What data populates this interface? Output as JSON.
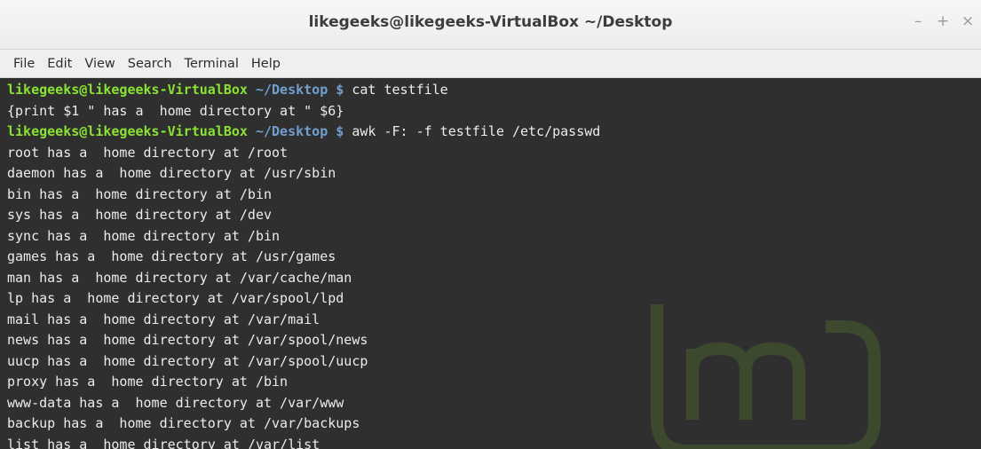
{
  "window": {
    "title": "likegeeks@likegeeks-VirtualBox ~/Desktop",
    "controls": {
      "minimize": "–",
      "maximize": "+",
      "close": "×"
    }
  },
  "menubar": {
    "items": [
      "File",
      "Edit",
      "View",
      "Search",
      "Terminal",
      "Help"
    ]
  },
  "terminal": {
    "lines": [
      {
        "type": "prompt",
        "user": "likegeeks@likegeeks-VirtualBox",
        "path": " ~/Desktop $ ",
        "cmd": "cat testfile"
      },
      {
        "type": "output",
        "text": "{print $1 \" has a  home directory at \" $6}"
      },
      {
        "type": "prompt",
        "user": "likegeeks@likegeeks-VirtualBox",
        "path": " ~/Desktop $ ",
        "cmd": "awk -F: -f testfile /etc/passwd"
      },
      {
        "type": "output",
        "text": "root has a  home directory at /root"
      },
      {
        "type": "output",
        "text": "daemon has a  home directory at /usr/sbin"
      },
      {
        "type": "output",
        "text": "bin has a  home directory at /bin"
      },
      {
        "type": "output",
        "text": "sys has a  home directory at /dev"
      },
      {
        "type": "output",
        "text": "sync has a  home directory at /bin"
      },
      {
        "type": "output",
        "text": "games has a  home directory at /usr/games"
      },
      {
        "type": "output",
        "text": "man has a  home directory at /var/cache/man"
      },
      {
        "type": "output",
        "text": "lp has a  home directory at /var/spool/lpd"
      },
      {
        "type": "output",
        "text": "mail has a  home directory at /var/mail"
      },
      {
        "type": "output",
        "text": "news has a  home directory at /var/spool/news"
      },
      {
        "type": "output",
        "text": "uucp has a  home directory at /var/spool/uucp"
      },
      {
        "type": "output",
        "text": "proxy has a  home directory at /bin"
      },
      {
        "type": "output",
        "text": "www-data has a  home directory at /var/www"
      },
      {
        "type": "output",
        "text": "backup has a  home directory at /var/backups"
      },
      {
        "type": "output",
        "text": "list has a  home directory at /var/list"
      }
    ]
  },
  "colors": {
    "prompt_user": "#8ae234",
    "prompt_path": "#729fcf",
    "terminal_bg": "#2f2f2f",
    "terminal_fg": "#ececec"
  },
  "watermark": "linux-mint-logo-icon"
}
